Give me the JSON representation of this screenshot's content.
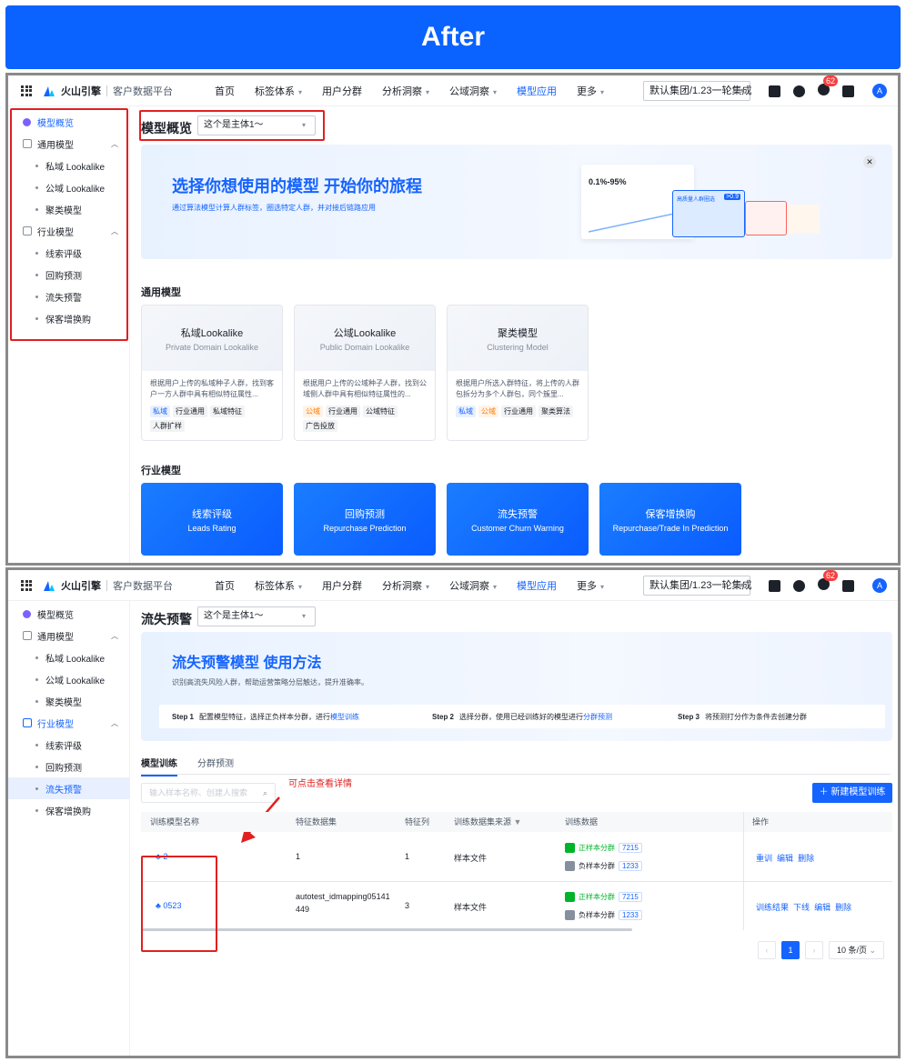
{
  "banner": "After",
  "topnav": {
    "brand": "火山引擎",
    "product": "客户数据平台",
    "items": [
      {
        "label": "首页",
        "caret": false
      },
      {
        "label": "标签体系",
        "caret": true
      },
      {
        "label": "用户分群",
        "caret": false
      },
      {
        "label": "分析洞察",
        "caret": true
      },
      {
        "label": "公域洞察",
        "caret": true
      },
      {
        "label": "模型应用",
        "caret": false,
        "active": true
      },
      {
        "label": "更多",
        "caret": true
      }
    ],
    "cluster": "默认集团/1.23一轮集成",
    "notif_count": "62",
    "avatar": "A"
  },
  "sidebar": {
    "overview": "模型概览",
    "general": "通用模型",
    "general_items": [
      "私域 Lookalike",
      "公域 Lookalike",
      "聚类模型"
    ],
    "industry": "行业模型",
    "industry_items": [
      "线索评级",
      "回购预测",
      "流失预警",
      "保客增换购"
    ]
  },
  "overview": {
    "title": "模型概览",
    "subject": "这个是主体1～",
    "hero_title_a": "选择你想使用的模型",
    "hero_title_b": "开始你的旅程",
    "hero_sub": "通过算法模型计算人群标签，圈选特定人群，并对接后链路应用",
    "hero_stat": "0.1%-95%",
    "hero_badge": ">0.9",
    "hero_card": "高质量人群圈选",
    "general_section": "通用模型",
    "cards": [
      {
        "t1": "私域Lookalike",
        "t2": "Private Domain Lookalike",
        "desc": "根据用户上传的私域种子人群，找到客户一方人群中具有相似特征属性...",
        "tags": [
          [
            "私域",
            "blue"
          ],
          [
            "行业通用",
            ""
          ],
          [
            "私域特征",
            ""
          ],
          [
            "人群扩样",
            ""
          ]
        ]
      },
      {
        "t1": "公域Lookalike",
        "t2": "Public Domain Lookalike",
        "desc": "根据用户上传的公域种子人群，找到公域侧人群中具有相似特征属性的...",
        "tags": [
          [
            "公域",
            "orange"
          ],
          [
            "行业通用",
            ""
          ],
          [
            "公域特征",
            ""
          ],
          [
            "广告投放",
            ""
          ]
        ]
      },
      {
        "t1": "聚类模型",
        "t2": "Clustering Model",
        "desc": "根据用户所选入群特征，将上传的人群包拆分为多个人群包，同个簇里...",
        "tags": [
          [
            "私域",
            "blue"
          ],
          [
            "公域",
            "orange"
          ],
          [
            "行业通用",
            ""
          ],
          [
            "聚类算法",
            ""
          ]
        ]
      }
    ],
    "industry_section": "行业模型",
    "industry_cards": [
      {
        "t1": "线索评级",
        "t2": "Leads Rating"
      },
      {
        "t1": "回购预测",
        "t2": "Repurchase Prediction"
      },
      {
        "t1": "流失预警",
        "t2": "Customer Churn Warning"
      },
      {
        "t1": "保客增换购",
        "t2": "Repurchase/Trade In Prediction"
      }
    ]
  },
  "churn": {
    "title": "流失预警",
    "subject": "这个是主体1～",
    "hero_title_a": "流失预警模型",
    "hero_title_b": "使用方法",
    "hero_sub": "识别高流失风险人群，帮助运营策略分层触达，提升准确率。",
    "steps": [
      {
        "num": "Step 1",
        "text": "配置模型特征，选择正负样本分群，进行",
        "link": "模型训练"
      },
      {
        "num": "Step 2",
        "text": "选择分群，使用已经训练好的模型进行",
        "link": "分群预测"
      },
      {
        "num": "Step 3",
        "text": "将预测打分作为条件去创建分群",
        "link": ""
      }
    ],
    "tabs": [
      "模型训练",
      "分群预测"
    ],
    "search_placeholder": "输入样本名称、创建人搜索",
    "annotation": "可点击查看详情",
    "new_button": "新建模型训练",
    "columns": [
      "训练模型名称",
      "特征数据集",
      "特征列",
      "训练数据集来源",
      "训练数据",
      "操作"
    ],
    "rows": [
      {
        "name": "2",
        "dataset": "1",
        "dataset2": "",
        "cols": "1",
        "source": "样本文件",
        "pos_label": "正样本分群",
        "pos": "7215",
        "neg_label": "负样本分群",
        "neg": "1233",
        "ops": [
          "重训",
          "编辑",
          "删除"
        ]
      },
      {
        "name": "0523",
        "dataset": "autotest_idmapping05141",
        "dataset2": "449",
        "cols": "3",
        "source": "样本文件",
        "pos_label": "正样本分群",
        "pos": "7215",
        "neg_label": "负样本分群",
        "neg": "1233",
        "ops": [
          "训练结果",
          "下线",
          "编辑",
          "删除"
        ]
      }
    ],
    "page": "1",
    "page_size": "10 条/页"
  }
}
